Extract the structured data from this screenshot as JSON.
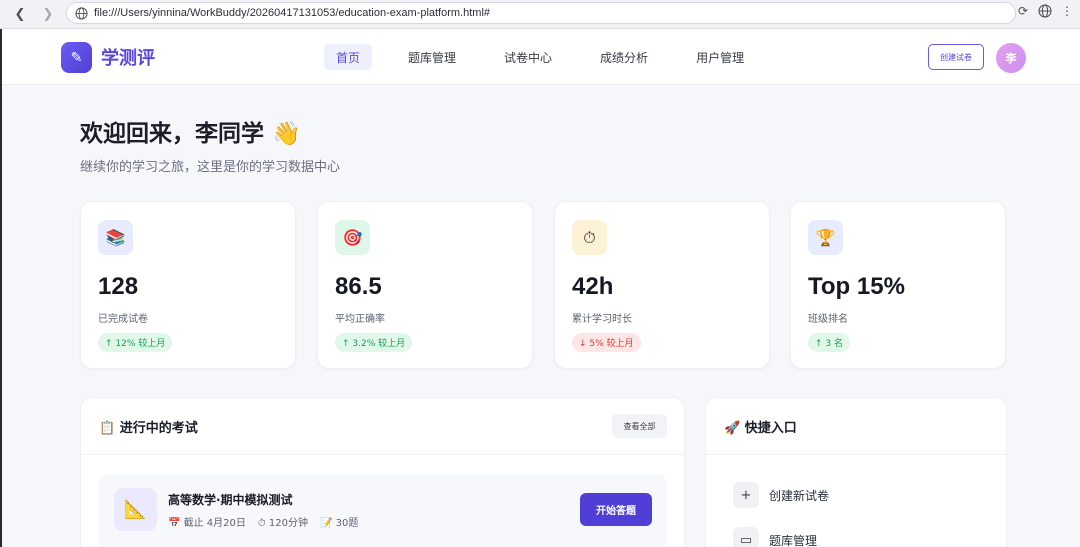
{
  "browser": {
    "url": "file:///Users/yinnina/WorkBuddy/20260417131053/education-exam-platform.html#"
  },
  "header": {
    "logo_icon": "notepad-icon",
    "brand": "学测评",
    "nav": [
      {
        "label": "首页",
        "active": true
      },
      {
        "label": "题库管理",
        "active": false
      },
      {
        "label": "试卷中心",
        "active": false
      },
      {
        "label": "成绩分析",
        "active": false
      },
      {
        "label": "用户管理",
        "active": false
      }
    ],
    "create_button": "创建试卷",
    "avatar_text": "李"
  },
  "welcome": {
    "title": "欢迎回来，李同学 👋",
    "subtitle": "继续你的学习之旅，这里是你的学习数据中心"
  },
  "stats": [
    {
      "icon": "books-icon",
      "glyph": "📚",
      "value": "128",
      "label": "已完成试卷",
      "badge": "↑ 12% 较上月",
      "trend": "up",
      "icon_bg": "#e7ebfd"
    },
    {
      "icon": "target-icon",
      "glyph": "🎯",
      "value": "86.5",
      "label": "平均正确率",
      "badge": "↑ 3.2% 较上月",
      "trend": "up",
      "icon_bg": "#dff6ea"
    },
    {
      "icon": "stopwatch-icon",
      "glyph": "⏱",
      "value": "42h",
      "label": "累计学习时长",
      "badge": "↓ 5% 较上月",
      "trend": "down",
      "icon_bg": "#fdf1d6"
    },
    {
      "icon": "trophy-icon",
      "glyph": "🏆",
      "value": "Top 15%",
      "label": "班级排名",
      "badge": "↑ 3 名",
      "trend": "up",
      "icon_bg": "#e7ebfd"
    }
  ],
  "exams": {
    "title": "📋 进行中的考试",
    "view_all": "查看全部",
    "items": [
      {
        "icon": "triangle-ruler-icon",
        "name": "高等数学·期中模拟测试",
        "deadline": "📅 截止 4月20日",
        "duration": "⏱ 120分钟",
        "questions": "📝 30题",
        "action": "开始答题"
      }
    ]
  },
  "quick": {
    "title": "🚀 快捷入口",
    "items": [
      {
        "icon": "plus-icon",
        "glyph": "+",
        "label": "创建新试卷"
      },
      {
        "icon": "folder-icon",
        "glyph": "▭",
        "label": "题库管理"
      }
    ]
  }
}
